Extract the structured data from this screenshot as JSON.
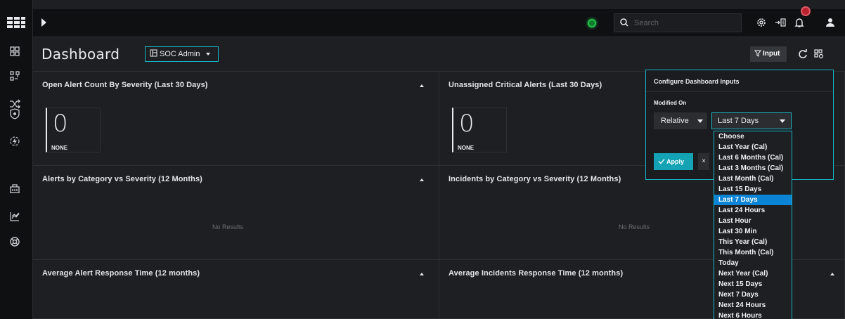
{
  "topbar": {
    "search_placeholder": "Search"
  },
  "header": {
    "title": "Dashboard",
    "role_label": "SOC Admin",
    "input_label": "Input"
  },
  "widgets": [
    {
      "title": "Open Alert Count By Severity (Last 30 Days)",
      "value": "0",
      "value_label": "NONE"
    },
    {
      "title": "Unassigned Critical Alerts (Last 30 Days)",
      "value": "0",
      "value_label": "NONE"
    },
    {
      "title": "Alerts by Category vs Severity (12 Months)",
      "empty_text": "No Results"
    },
    {
      "title": "Incidents by Category vs Severity (12 Months)",
      "empty_text": "No Results"
    },
    {
      "title": "Average Alert Response Time (12 months)"
    },
    {
      "title": "Average Incidents Response Time (12 months)"
    }
  ],
  "config_panel": {
    "title": "Configure Dashboard Inputs",
    "field_label": "Modified On",
    "relative_value": "Relative",
    "range_value": "Last 7 Days",
    "apply_label": "Apply",
    "close_label": "×"
  },
  "dropdown": {
    "selected": "Last 7 Days",
    "options": [
      "Choose",
      "Last Year (Cal)",
      "Last 6 Months (Cal)",
      "Last 3 Months (Cal)",
      "Last Month (Cal)",
      "Last 15 Days",
      "Last 7 Days",
      "Last 24 Hours",
      "Last Hour",
      "Last 30 Min",
      "This Year (Cal)",
      "This Month (Cal)",
      "Today",
      "Next Year (Cal)",
      "Next 15 Days",
      "Next 7 Days",
      "Next 24 Hours",
      "Next 6 Hours"
    ]
  },
  "colors": {
    "accent": "#18b3c4",
    "selected_option": "#0b84d6",
    "status_online": "#22c24a",
    "notification_badge": "#b8232f"
  },
  "icons": {
    "sidebar": [
      "dashboard-icon",
      "workflow-icon",
      "shuffle-icon",
      "shield-icon",
      "lightning-icon",
      "building-icon",
      "chart-icon",
      "support-icon"
    ],
    "topbar": [
      "settings-icon",
      "panel-toggle-icon",
      "bell-icon",
      "user-icon"
    ]
  }
}
